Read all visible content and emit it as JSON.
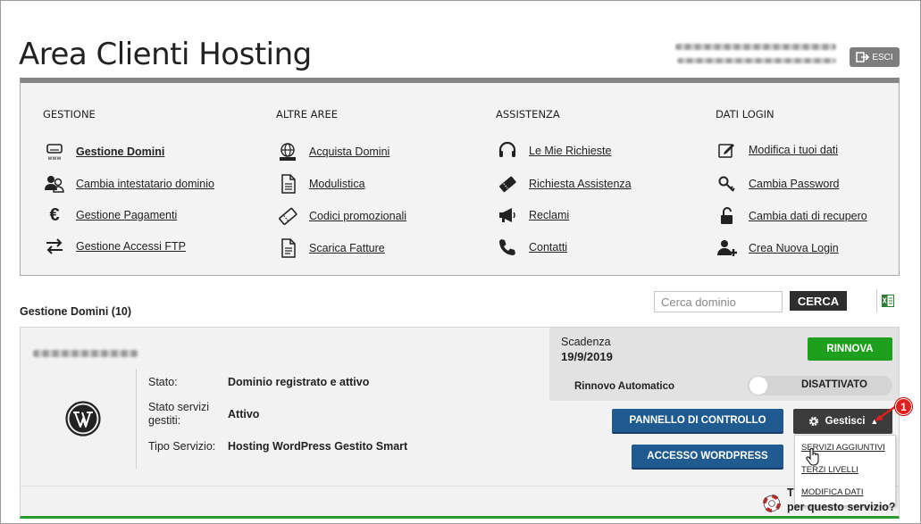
{
  "header": {
    "title": "Area Clienti Hosting",
    "exit_label": "ESCI"
  },
  "menu": {
    "gestione": {
      "heading": "GESTIONE",
      "items": [
        {
          "label": "Gestione Domini",
          "icon": "www-drive-icon"
        },
        {
          "label": "Cambia intestatario dominio",
          "icon": "users-icon"
        },
        {
          "label": "Gestione Pagamenti",
          "icon": "euro-icon"
        },
        {
          "label": "Gestione Accessi FTP",
          "icon": "transfer-arrows-icon"
        }
      ]
    },
    "altre": {
      "heading": "ALTRE AREE",
      "items": [
        {
          "label": "Acquista Domini",
          "icon": "globe-www-icon"
        },
        {
          "label": "Modulistica",
          "icon": "document-icon"
        },
        {
          "label": "Codici promozionali",
          "icon": "ticket-icon"
        },
        {
          "label": "Scarica Fatture",
          "icon": "invoice-icon"
        }
      ]
    },
    "assistenza": {
      "heading": "ASSISTENZA",
      "items": [
        {
          "label": "Le Mie Richieste",
          "icon": "headset-icon"
        },
        {
          "label": "Richiesta Assistenza",
          "icon": "ticket-icon"
        },
        {
          "label": "Reclami",
          "icon": "megaphone-icon"
        },
        {
          "label": "Contatti",
          "icon": "phone-icon"
        }
      ]
    },
    "login": {
      "heading": "DATI LOGIN",
      "items": [
        {
          "label": "Modifica i tuoi dati",
          "icon": "edit-icon"
        },
        {
          "label": "Cambia Password",
          "icon": "key-icon"
        },
        {
          "label": "Cambia dati di recupero",
          "icon": "unlock-icon"
        },
        {
          "label": "Crea Nuova Login",
          "icon": "add-user-icon"
        }
      ]
    }
  },
  "domains": {
    "title": "Gestione Domini (10)",
    "search_placeholder": "Cerca dominio",
    "search_button": "CERCA"
  },
  "card": {
    "labels": {
      "status": "Stato:",
      "services_1": "Stato servizi",
      "services_2": "gestiti:",
      "type": "Tipo Servizio:"
    },
    "values": {
      "status": "Dominio registrato e attivo",
      "services": "Attivo",
      "type": "Hosting WordPress Gestito Smart"
    },
    "expiry_label": "Scadenza",
    "expiry_date": "19/9/2019",
    "renew": "RINNOVA",
    "auto_renew_label": "Rinnovo Automatico",
    "auto_renew_state": "DISATTIVATO",
    "control_panel": "PANNELLO DI CONTROLLO",
    "wp_access": "ACCESSO WORDPRESS",
    "manage": "Gestisci",
    "dropdown": [
      "SERVIZI AGGIUNTIVI",
      "TERZI LIVELLI",
      "MODIFICA DATI"
    ],
    "callout_number": "1",
    "help_line1": "T",
    "help_line2": "per questo servizio?"
  },
  "colors": {
    "accent_green": "#1ea01e",
    "accent_blue": "#1f5a91",
    "dark": "#3b3b3b",
    "callout_red": "#e0201e"
  }
}
